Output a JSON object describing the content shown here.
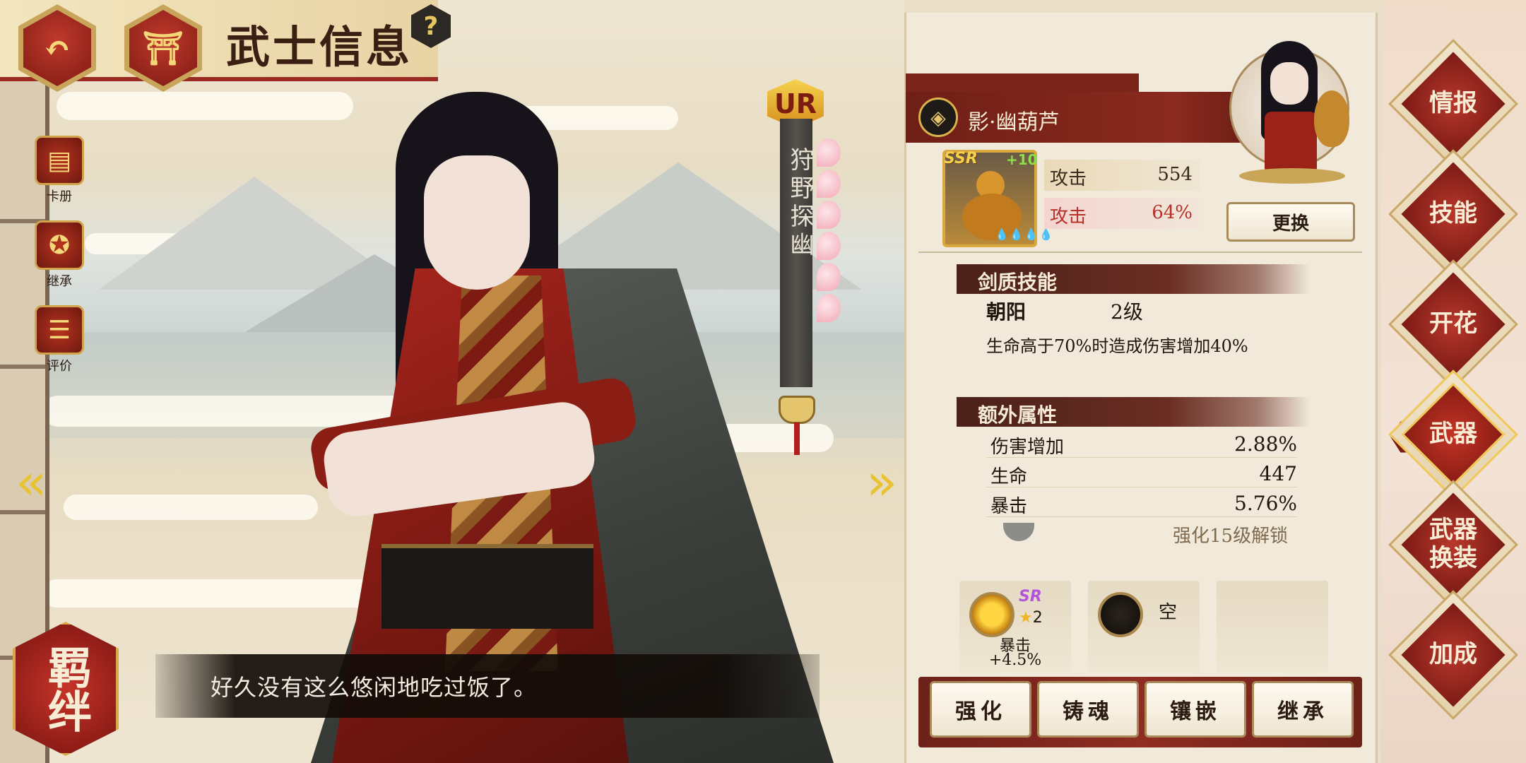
{
  "header": {
    "back_icon": "back-arrow-icon",
    "home_icon": "torii-gate-icon",
    "title": "武士信息",
    "help_label": "?"
  },
  "sidebar": {
    "items": [
      {
        "label": "卡册",
        "icon": "card-album-icon"
      },
      {
        "label": "继承",
        "icon": "pentagram-icon"
      },
      {
        "label": "评价",
        "icon": "review-icon"
      }
    ]
  },
  "character": {
    "rarity": "UR",
    "name": "狩野探幽",
    "dialogue": "好久没有这么悠闲地吃过饭了。",
    "bond_label": "羁绊"
  },
  "weapon": {
    "name": "影·幽葫芦",
    "rarity": "SSR",
    "enhance_level": "+10",
    "drops": "💧💧💧💧",
    "stats": [
      {
        "label": "攻击",
        "value": "554"
      },
      {
        "label": "攻击",
        "value": "64%"
      }
    ],
    "change_button": "更换"
  },
  "sword_skill": {
    "heading": "剑质技能",
    "name": "朝阳",
    "level": "2级",
    "description": "生命高于70%时造成伤害增加40%"
  },
  "extra_attributes": {
    "heading": "额外属性",
    "rows": [
      {
        "label": "伤害增加",
        "value": "2.88%"
      },
      {
        "label": "生命",
        "value": "447"
      },
      {
        "label": "暴击",
        "value": "5.76%"
      }
    ],
    "locked_text": "强化15级解锁"
  },
  "gem_slots": [
    {
      "rarity": "SR",
      "stars": "2",
      "star_icon": "★",
      "stat": "暴击",
      "value": "+4.5%"
    },
    {
      "label": "空"
    },
    {}
  ],
  "actions": [
    "强化",
    "铸魂",
    "镶嵌",
    "继承"
  ],
  "right_nav": [
    {
      "label": "情报"
    },
    {
      "label": "技能"
    },
    {
      "label": "开花"
    },
    {
      "label": "武器",
      "active": true
    },
    {
      "label": "武器换装"
    },
    {
      "label": "加成"
    }
  ],
  "colors": {
    "accent_red": "#8b2a1e",
    "gold": "#d9a93e",
    "attack_pct_red": "#b6302a",
    "panel_bg": "#f1eadb"
  }
}
